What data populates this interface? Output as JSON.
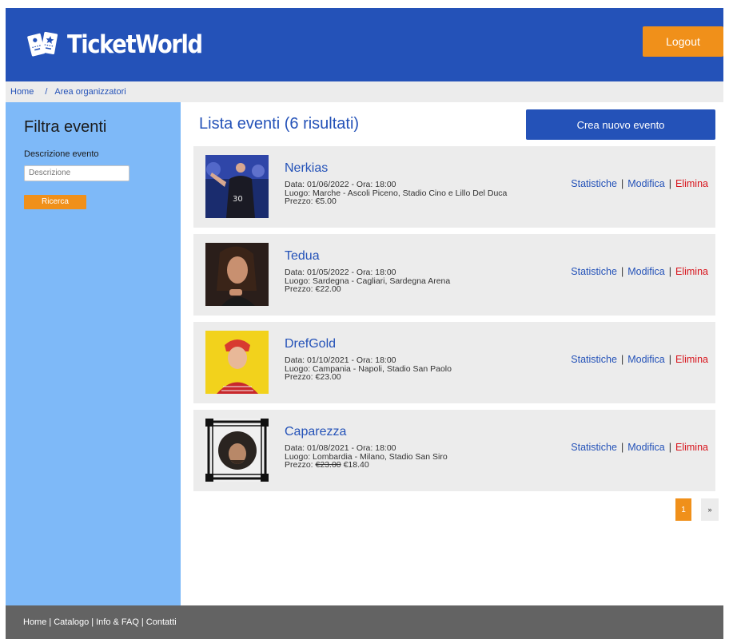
{
  "header": {
    "brand": "TicketWorld",
    "logout_label": "Logout"
  },
  "breadcrumb": {
    "home": "Home",
    "separator": "/",
    "current": "Area organizzatori"
  },
  "sidebar": {
    "title": "Filtra eventi",
    "description_label": "Descrizione evento",
    "description_placeholder": "Descrizione",
    "search_label": "Ricerca"
  },
  "main": {
    "title": "Lista eventi (6 risultati)",
    "create_label": "Crea nuovo evento",
    "actions": {
      "stats": "Statistiche",
      "separator": "|",
      "edit": "Modifica",
      "delete": "Elimina"
    },
    "events": [
      {
        "name": "Nerkias",
        "date_line": "Data: 01/06/2022 - Ora: 18:00",
        "place_line": "Luogo: Marche - Ascoli Piceno, Stadio Cino e Lillo Del Duca",
        "price_label": "Prezzo: ",
        "old_price": "",
        "price": "€5.00"
      },
      {
        "name": "Tedua",
        "date_line": "Data: 01/05/2022 - Ora: 18:00",
        "place_line": "Luogo: Sardegna - Cagliari, Sardegna Arena",
        "price_label": "Prezzo: ",
        "old_price": "",
        "price": "€22.00"
      },
      {
        "name": "DrefGold",
        "date_line": "Data: 01/10/2021 - Ora: 18:00",
        "place_line": "Luogo: Campania - Napoli, Stadio San Paolo",
        "price_label": "Prezzo: ",
        "old_price": "",
        "price": "€23.00"
      },
      {
        "name": "Caparezza",
        "date_line": "Data: 01/08/2021 - Ora: 18:00",
        "place_line": "Luogo: Lombardia - Milano, Stadio San Siro",
        "price_label": "Prezzo: ",
        "old_price": "€23.00",
        "price": "€18.40"
      }
    ],
    "pagination": {
      "current_page": "1",
      "next_label": "»"
    }
  },
  "footer": {
    "links": [
      "Home",
      "Catalogo",
      "Info & FAQ",
      "Contatti"
    ],
    "separator": "|"
  },
  "colors": {
    "primary_blue": "#2452b8",
    "accent_orange": "#f0901a",
    "sidebar_blue": "#7eb9f8",
    "delete_red": "#d8141c",
    "footer_gray": "#636363"
  },
  "icons": {
    "logo": "tickets-icon"
  }
}
